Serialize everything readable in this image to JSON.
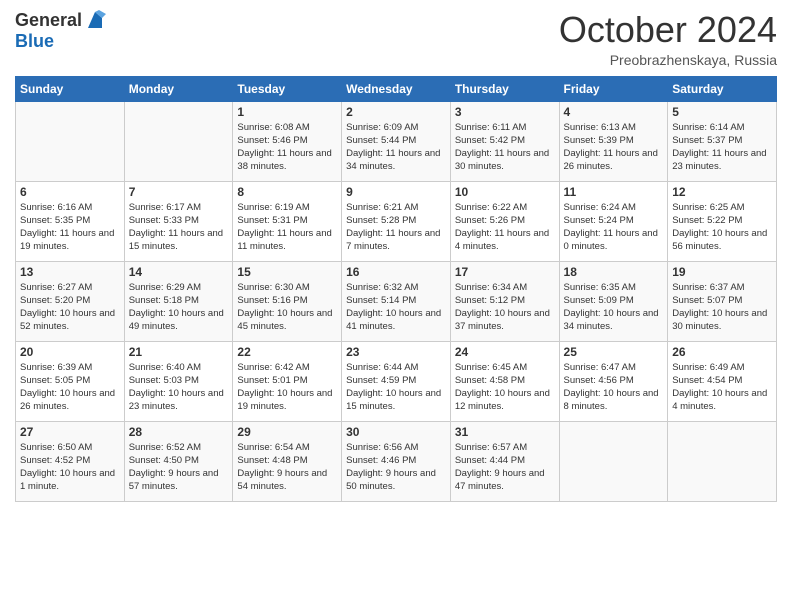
{
  "header": {
    "logo_general": "General",
    "logo_blue": "Blue",
    "month": "October 2024",
    "location": "Preobrazhenskaya, Russia"
  },
  "days_of_week": [
    "Sunday",
    "Monday",
    "Tuesday",
    "Wednesday",
    "Thursday",
    "Friday",
    "Saturday"
  ],
  "weeks": [
    [
      {
        "day": "",
        "content": ""
      },
      {
        "day": "",
        "content": ""
      },
      {
        "day": "1",
        "content": "Sunrise: 6:08 AM\nSunset: 5:46 PM\nDaylight: 11 hours and 38 minutes."
      },
      {
        "day": "2",
        "content": "Sunrise: 6:09 AM\nSunset: 5:44 PM\nDaylight: 11 hours and 34 minutes."
      },
      {
        "day": "3",
        "content": "Sunrise: 6:11 AM\nSunset: 5:42 PM\nDaylight: 11 hours and 30 minutes."
      },
      {
        "day": "4",
        "content": "Sunrise: 6:13 AM\nSunset: 5:39 PM\nDaylight: 11 hours and 26 minutes."
      },
      {
        "day": "5",
        "content": "Sunrise: 6:14 AM\nSunset: 5:37 PM\nDaylight: 11 hours and 23 minutes."
      }
    ],
    [
      {
        "day": "6",
        "content": "Sunrise: 6:16 AM\nSunset: 5:35 PM\nDaylight: 11 hours and 19 minutes."
      },
      {
        "day": "7",
        "content": "Sunrise: 6:17 AM\nSunset: 5:33 PM\nDaylight: 11 hours and 15 minutes."
      },
      {
        "day": "8",
        "content": "Sunrise: 6:19 AM\nSunset: 5:31 PM\nDaylight: 11 hours and 11 minutes."
      },
      {
        "day": "9",
        "content": "Sunrise: 6:21 AM\nSunset: 5:28 PM\nDaylight: 11 hours and 7 minutes."
      },
      {
        "day": "10",
        "content": "Sunrise: 6:22 AM\nSunset: 5:26 PM\nDaylight: 11 hours and 4 minutes."
      },
      {
        "day": "11",
        "content": "Sunrise: 6:24 AM\nSunset: 5:24 PM\nDaylight: 11 hours and 0 minutes."
      },
      {
        "day": "12",
        "content": "Sunrise: 6:25 AM\nSunset: 5:22 PM\nDaylight: 10 hours and 56 minutes."
      }
    ],
    [
      {
        "day": "13",
        "content": "Sunrise: 6:27 AM\nSunset: 5:20 PM\nDaylight: 10 hours and 52 minutes."
      },
      {
        "day": "14",
        "content": "Sunrise: 6:29 AM\nSunset: 5:18 PM\nDaylight: 10 hours and 49 minutes."
      },
      {
        "day": "15",
        "content": "Sunrise: 6:30 AM\nSunset: 5:16 PM\nDaylight: 10 hours and 45 minutes."
      },
      {
        "day": "16",
        "content": "Sunrise: 6:32 AM\nSunset: 5:14 PM\nDaylight: 10 hours and 41 minutes."
      },
      {
        "day": "17",
        "content": "Sunrise: 6:34 AM\nSunset: 5:12 PM\nDaylight: 10 hours and 37 minutes."
      },
      {
        "day": "18",
        "content": "Sunrise: 6:35 AM\nSunset: 5:09 PM\nDaylight: 10 hours and 34 minutes."
      },
      {
        "day": "19",
        "content": "Sunrise: 6:37 AM\nSunset: 5:07 PM\nDaylight: 10 hours and 30 minutes."
      }
    ],
    [
      {
        "day": "20",
        "content": "Sunrise: 6:39 AM\nSunset: 5:05 PM\nDaylight: 10 hours and 26 minutes."
      },
      {
        "day": "21",
        "content": "Sunrise: 6:40 AM\nSunset: 5:03 PM\nDaylight: 10 hours and 23 minutes."
      },
      {
        "day": "22",
        "content": "Sunrise: 6:42 AM\nSunset: 5:01 PM\nDaylight: 10 hours and 19 minutes."
      },
      {
        "day": "23",
        "content": "Sunrise: 6:44 AM\nSunset: 4:59 PM\nDaylight: 10 hours and 15 minutes."
      },
      {
        "day": "24",
        "content": "Sunrise: 6:45 AM\nSunset: 4:58 PM\nDaylight: 10 hours and 12 minutes."
      },
      {
        "day": "25",
        "content": "Sunrise: 6:47 AM\nSunset: 4:56 PM\nDaylight: 10 hours and 8 minutes."
      },
      {
        "day": "26",
        "content": "Sunrise: 6:49 AM\nSunset: 4:54 PM\nDaylight: 10 hours and 4 minutes."
      }
    ],
    [
      {
        "day": "27",
        "content": "Sunrise: 6:50 AM\nSunset: 4:52 PM\nDaylight: 10 hours and 1 minute."
      },
      {
        "day": "28",
        "content": "Sunrise: 6:52 AM\nSunset: 4:50 PM\nDaylight: 9 hours and 57 minutes."
      },
      {
        "day": "29",
        "content": "Sunrise: 6:54 AM\nSunset: 4:48 PM\nDaylight: 9 hours and 54 minutes."
      },
      {
        "day": "30",
        "content": "Sunrise: 6:56 AM\nSunset: 4:46 PM\nDaylight: 9 hours and 50 minutes."
      },
      {
        "day": "31",
        "content": "Sunrise: 6:57 AM\nSunset: 4:44 PM\nDaylight: 9 hours and 47 minutes."
      },
      {
        "day": "",
        "content": ""
      },
      {
        "day": "",
        "content": ""
      }
    ]
  ]
}
